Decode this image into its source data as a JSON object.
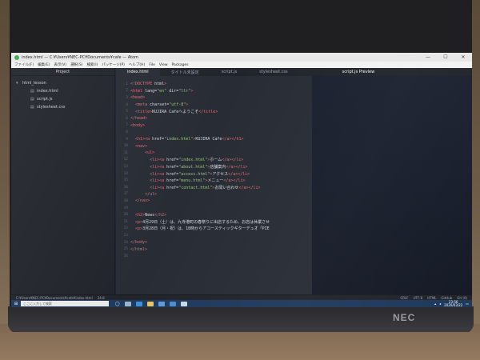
{
  "window": {
    "title": "index.html — C:¥Users¥NEC-PC¥Documents¥cafe — Atom",
    "controls": [
      "—",
      "☐",
      "✕"
    ]
  },
  "menu": [
    "ファイル(F)",
    "編集(E)",
    "表示(V)",
    "選択(S)",
    "検索(I)",
    "パッケージ(P)",
    "ヘルプ(H)",
    "File",
    "View",
    "Packages"
  ],
  "tree": {
    "header": "Project",
    "folder": "html_lesson",
    "files": [
      "index.html",
      "script.js",
      "stylesheet.css"
    ]
  },
  "tabs": [
    {
      "label": "index.html",
      "active": true
    },
    {
      "label": "タイトル未設定"
    },
    {
      "label": "script.js"
    },
    {
      "label": "stylesheet.css"
    },
    {
      "label": "script.js Preview",
      "preview": true
    }
  ],
  "code_lines": [
    {
      "n": "1",
      "t": "<!DOCTYPE html>"
    },
    {
      "n": "2",
      "t": "<html lang=\"en\" dir=\"ltr\">"
    },
    {
      "n": "3",
      "t": "<head>"
    },
    {
      "n": "4",
      "t": "  <meta charset=\"utf-8\">"
    },
    {
      "n": "5",
      "t": "  <title>KUJIRA Cafeへようこそ</title>"
    },
    {
      "n": "6",
      "t": "</head>"
    },
    {
      "n": "7",
      "t": "<body>"
    },
    {
      "n": "8",
      "t": ""
    },
    {
      "n": "9",
      "t": "  <h1><a href=\"index.html\">KUJIRA Cafe</a></h1>"
    },
    {
      "n": "10",
      "t": "  <nav>"
    },
    {
      "n": "11",
      "t": "      <ul>"
    },
    {
      "n": "12",
      "t": "        <li><a href=\"index.html\">ホーム</a></li>"
    },
    {
      "n": "13",
      "t": "        <li><a href=\"about.html\">店舗案内</a></li>"
    },
    {
      "n": "14",
      "t": "        <li><a href=\"access.html\">アクセス</a></li>"
    },
    {
      "n": "15",
      "t": "        <li><a href=\"menu.html\">メニュー</a></li>"
    },
    {
      "n": "16",
      "t": "        <li><a href=\"contact.html\">お問い合わせ</a></li>"
    },
    {
      "n": "17",
      "t": "      </ul>"
    },
    {
      "n": "18",
      "t": "  </nav>"
    },
    {
      "n": "19",
      "t": ""
    },
    {
      "n": "20",
      "t": "  <h2>News</h2>"
    },
    {
      "n": "21",
      "t": "  <p>4月29日（土）は、九寺港町の春祭りに出店するため、お店は休業させ"
    },
    {
      "n": "22",
      "t": "  <p>3月28日（月・祝）は、18時からアコースティックギターデュオ「PIE"
    },
    {
      "n": "23",
      "t": ""
    },
    {
      "n": "24",
      "t": "</body>"
    },
    {
      "n": "25",
      "t": "</html>"
    },
    {
      "n": "26",
      "t": ""
    }
  ],
  "status": {
    "path": "C:¥Users¥NEC-PC¥Documents¥cafe¥index.html",
    "cursor": "24:8",
    "crlf": "CRLF",
    "encoding": "UTF-8",
    "grammar": "HTML",
    "github": "GitHub",
    "git": "Git (0)"
  },
  "taskbar": {
    "search_placeholder": "ここに入力して検索",
    "time": "23:56",
    "date": "2020/03/22"
  },
  "brand": "NEC"
}
